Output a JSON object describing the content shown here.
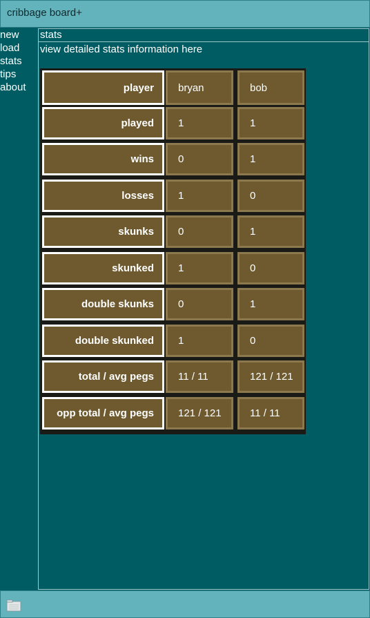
{
  "app": {
    "title": "cribbage board+"
  },
  "nav": {
    "items": [
      "new",
      "load",
      "stats",
      "tips",
      "about"
    ]
  },
  "page": {
    "heading": "stats",
    "subtitle": "view detailed stats information here"
  },
  "stats": {
    "header": {
      "label": "player",
      "p1": "bryan",
      "p2": "bob"
    },
    "rows": [
      {
        "label": "played",
        "p1": "1",
        "p2": "1"
      },
      {
        "label": "wins",
        "p1": "0",
        "p2": "1"
      },
      {
        "label": "losses",
        "p1": "1",
        "p2": "0"
      },
      {
        "label": "skunks",
        "p1": "0",
        "p2": "1"
      },
      {
        "label": "skunked",
        "p1": "1",
        "p2": "0"
      },
      {
        "label": "double skunks",
        "p1": "0",
        "p2": "1"
      },
      {
        "label": "double skunked",
        "p1": "1",
        "p2": "0"
      },
      {
        "label": "total / avg pegs",
        "p1": "11 / 11",
        "p2": "121 / 121"
      },
      {
        "label": "opp total / avg pegs",
        "p1": "121 / 121",
        "p2": "11 / 11"
      }
    ]
  },
  "bottom": {
    "icon": "folder-icon"
  }
}
